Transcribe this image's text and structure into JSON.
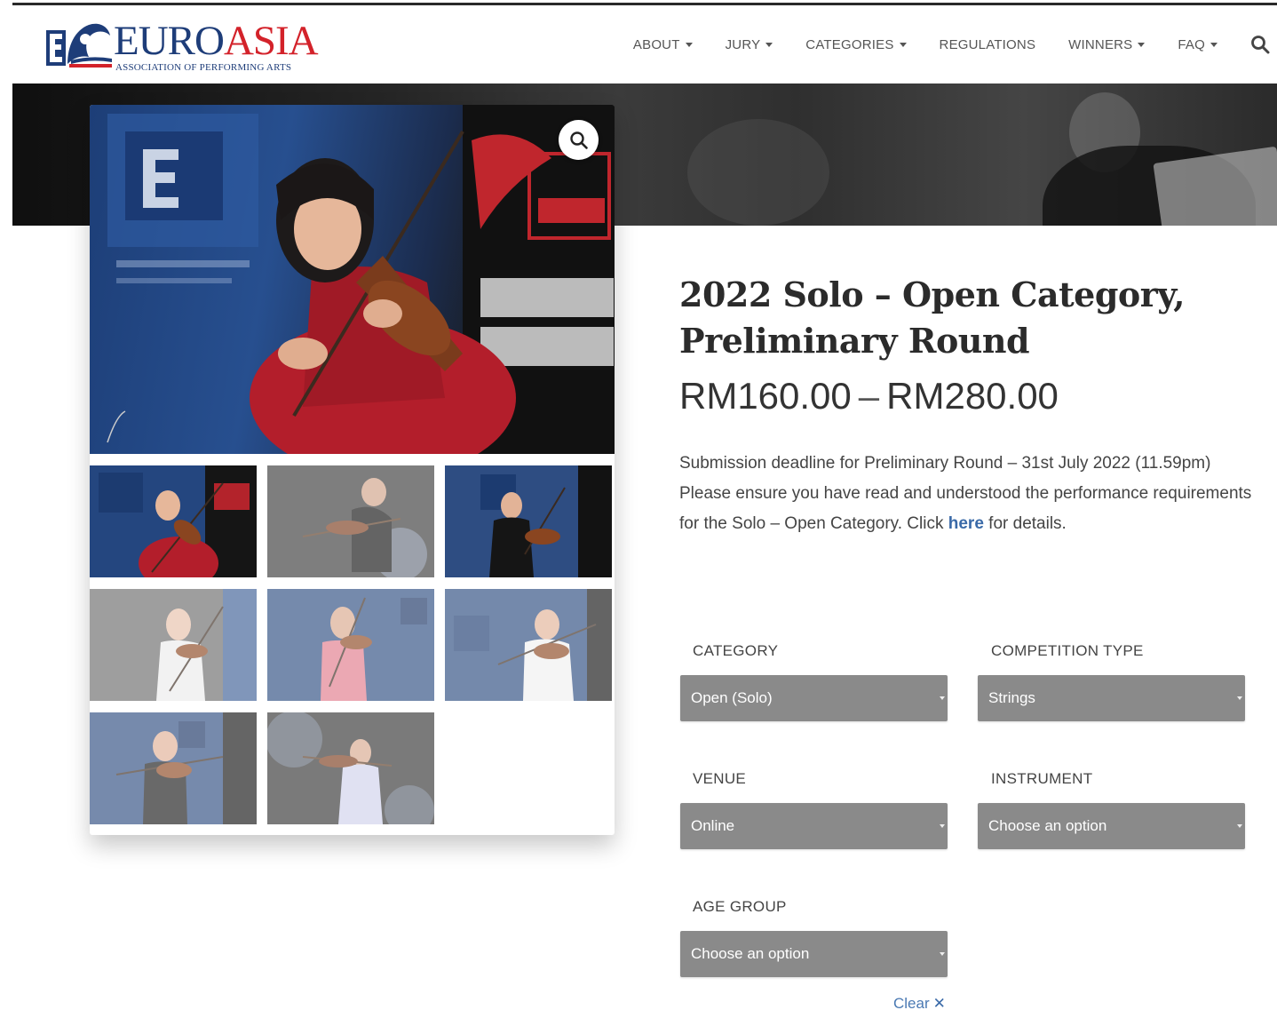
{
  "logo": {
    "word_primary": "EURO",
    "word_accent": "ASIA",
    "subtitle": "ASSOCIATION OF PERFORMING ARTS",
    "colors": {
      "navy": "#1e3d79",
      "red": "#d3222a"
    }
  },
  "nav": {
    "items": [
      {
        "label": "ABOUT",
        "dropdown": true
      },
      {
        "label": "JURY",
        "dropdown": true
      },
      {
        "label": "CATEGORIES",
        "dropdown": true
      },
      {
        "label": "REGULATIONS",
        "dropdown": false
      },
      {
        "label": "WINNERS",
        "dropdown": true
      },
      {
        "label": "FAQ",
        "dropdown": true
      }
    ],
    "search_icon": "search-icon"
  },
  "gallery": {
    "zoom_icon": "zoom-search-icon",
    "thumbnail_count": 8
  },
  "product": {
    "title": "2022 Solo – Open Category, Preliminary Round",
    "price_min": "RM160.00",
    "price_sep": "–",
    "price_max": "RM280.00",
    "description_text": "Submission deadline for Preliminary Round – 31st July  2022 (11.59pm) Please ensure you have read and understood the performance requirements for the Solo – Open Category. Click ",
    "description_link": "here",
    "description_tail": " for details."
  },
  "variations": {
    "category": {
      "label": "CATEGORY",
      "value": "Open (Solo)"
    },
    "competition_type": {
      "label": "COMPETITION TYPE",
      "value": "Strings"
    },
    "venue": {
      "label": "VENUE",
      "value": "Online"
    },
    "instrument": {
      "label": "INSTRUMENT",
      "value": "Choose an option"
    },
    "age_group": {
      "label": "AGE GROUP",
      "value": "Choose an option"
    },
    "clear_label": "Clear",
    "clear_icon": "close-icon"
  },
  "colors": {
    "select_bg": "#8a8a8a",
    "link": "#3a6aa8"
  }
}
